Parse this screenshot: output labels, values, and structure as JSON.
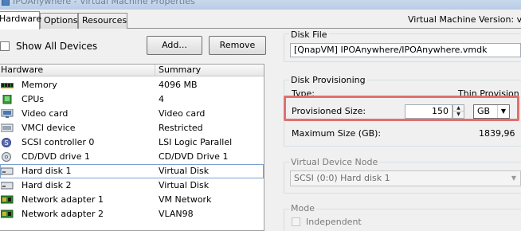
{
  "window": {
    "title": "IPOAnywhere - Virtual Machine Properties"
  },
  "tabs": [
    {
      "label": "Hardware",
      "active": true
    },
    {
      "label": "Options",
      "active": false
    },
    {
      "label": "Resources",
      "active": false
    }
  ],
  "vm_version_label": "Virtual Machine Version: vmx-",
  "left": {
    "show_all_label": "Show All Devices",
    "add_label": "Add...",
    "remove_label": "Remove",
    "columns": [
      "Hardware",
      "Summary"
    ],
    "rows": [
      {
        "name": "Memory",
        "summary": "4096 MB",
        "icon": "memory-icon"
      },
      {
        "name": "CPUs",
        "summary": "4",
        "icon": "cpu-icon"
      },
      {
        "name": "Video card",
        "summary": "Video card",
        "icon": "video-card-icon"
      },
      {
        "name": "VMCI device",
        "summary": "Restricted",
        "icon": "vmci-icon"
      },
      {
        "name": "SCSI controller 0",
        "summary": "LSI Logic Parallel",
        "icon": "scsi-icon"
      },
      {
        "name": "CD/DVD drive 1",
        "summary": "CD/DVD Drive 1",
        "icon": "cd-dvd-icon"
      },
      {
        "name": "Hard disk 1",
        "summary": "Virtual Disk",
        "icon": "hard-disk-icon",
        "selected": true
      },
      {
        "name": "Hard disk 2",
        "summary": "Virtual Disk",
        "icon": "hard-disk-icon"
      },
      {
        "name": "Network adapter 1",
        "summary": "VM Network",
        "icon": "network-adapter-icon"
      },
      {
        "name": "Network adapter 2",
        "summary": "VLAN98",
        "icon": "network-adapter-icon"
      }
    ]
  },
  "right": {
    "disk_file": {
      "label": "Disk File",
      "value": "[QnapVM] IPOAnywhere/IPOAnywhere.vmdk"
    },
    "provisioning": {
      "label": "Disk Provisioning",
      "type_label": "Type:",
      "type_value": "Thin Provision",
      "provisioned_label": "Provisioned Size:",
      "provisioned_value": "150",
      "unit": "GB",
      "max_label": "Maximum Size (GB):",
      "max_value": "1839,96"
    },
    "device_node": {
      "label": "Virtual Device Node",
      "value": "SCSI (0:0) Hard disk 1"
    },
    "mode": {
      "label": "Mode",
      "independent_label": "Independent"
    }
  },
  "colors": {
    "highlight": "#e0706e",
    "selection_border": "#7da2ce"
  }
}
